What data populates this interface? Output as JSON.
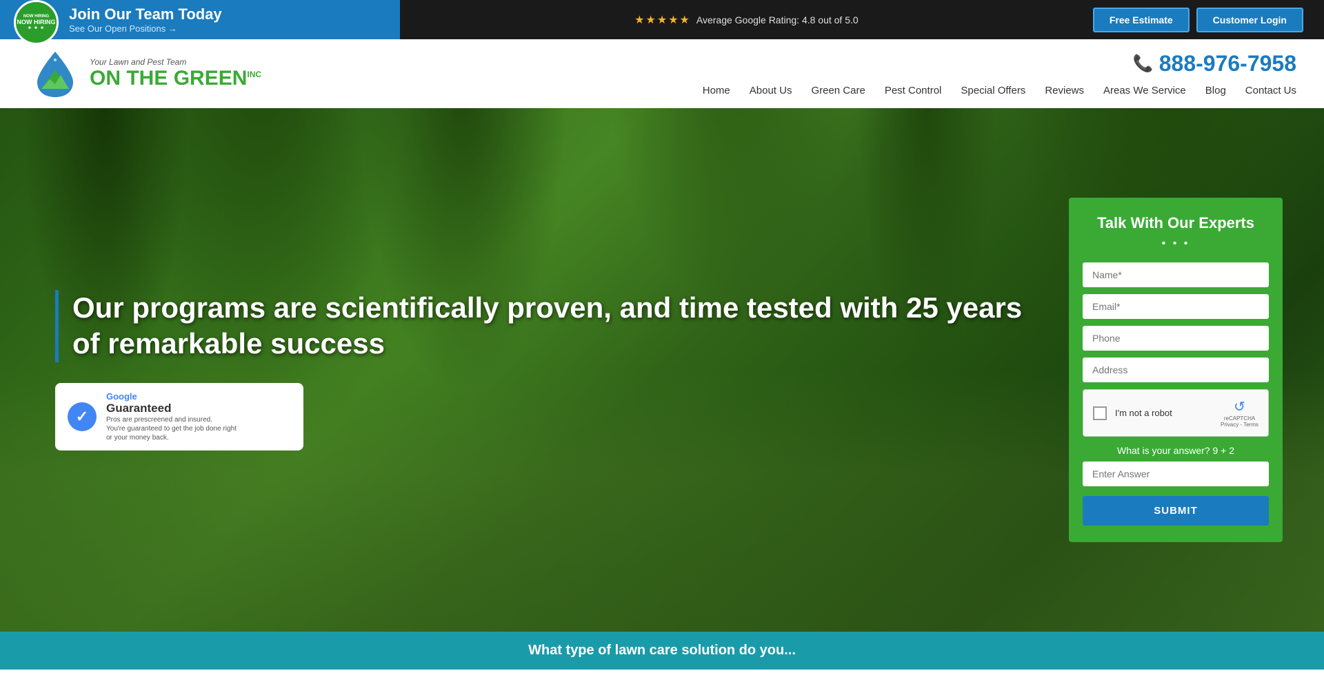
{
  "topbar": {
    "hiring_title": "Join Our Team Today",
    "hiring_subtitle": "See Our Open Positions →",
    "rating_stars": "★★★★★",
    "rating_text": "Average Google Rating: 4.8 out of 5.0",
    "free_estimate_label": "Free Estimate",
    "customer_login_label": "Customer Login",
    "badge_line1": "NOW HIRING",
    "badge_line2": "NOW HIRING",
    "badge_stars": "★ ★ ★"
  },
  "header": {
    "tagline": "Your Lawn and Pest Team",
    "logo_on": "ON THE",
    "logo_green": "GREEN",
    "logo_inc": "inc",
    "phone": "888-976-7958"
  },
  "nav": {
    "items": [
      {
        "label": "Home",
        "id": "home"
      },
      {
        "label": "About Us",
        "id": "about"
      },
      {
        "label": "Green Care",
        "id": "green-care"
      },
      {
        "label": "Pest Control",
        "id": "pest-control"
      },
      {
        "label": "Special Offers",
        "id": "special-offers"
      },
      {
        "label": "Reviews",
        "id": "reviews"
      },
      {
        "label": "Areas We Service",
        "id": "areas"
      },
      {
        "label": "Blog",
        "id": "blog"
      },
      {
        "label": "Contact Us",
        "id": "contact"
      }
    ]
  },
  "hero": {
    "title": "Our programs are scientifically proven, and time tested with 25 years of remarkable success",
    "google_text": "Google",
    "guaranteed_text": "Guaranteed",
    "fine_print": "Pros are prescreened and insured.\nYou're guaranteed to get the job done right\nor your money back."
  },
  "form": {
    "title": "Talk With Our Experts",
    "dots": "• • •",
    "name_placeholder": "Name*",
    "email_placeholder": "Email*",
    "phone_placeholder": "Phone",
    "address_placeholder": "Address",
    "recaptcha_label": "I'm not a robot",
    "recaptcha_badge": "reCAPTCHA",
    "recaptcha_links": "Privacy - Terms",
    "math_question": "What is your answer? 9 + 2",
    "math_placeholder": "Enter Answer",
    "submit_label": "SUBMIT"
  },
  "bottom_bar": {
    "text": "What type of lawn care solution do you..."
  }
}
